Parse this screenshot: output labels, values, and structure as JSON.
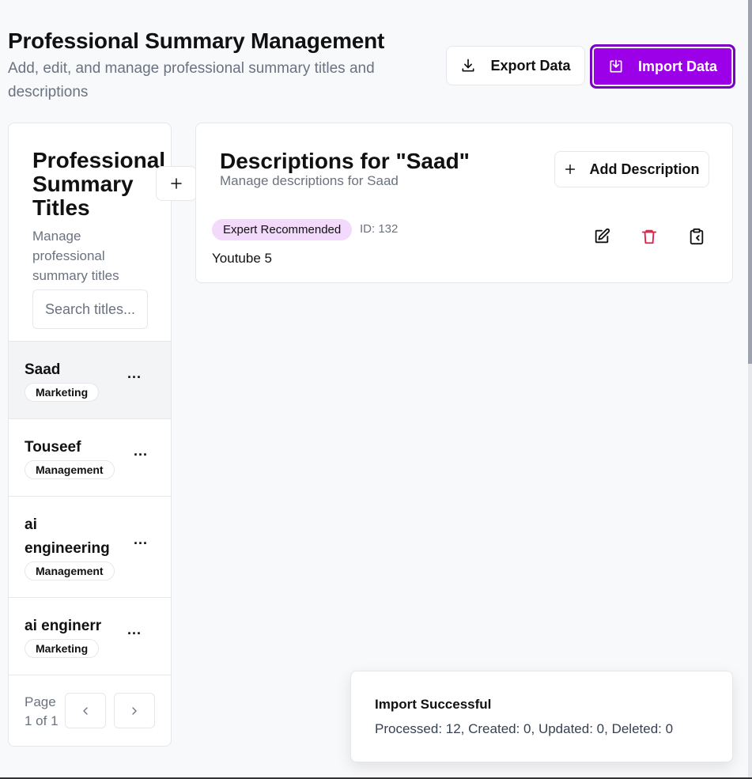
{
  "header": {
    "title": "Professional Summary Management",
    "subtitle": "Add, edit, and manage professional summary titles and descriptions",
    "export_label": "Export Data",
    "import_label": "Import Data"
  },
  "sidebar": {
    "title": "Professional Summary Titles",
    "description": "Manage professional summary titles",
    "search_placeholder": "Search titles...",
    "items": [
      {
        "name": "Saad",
        "category": "Marketing",
        "more": "..."
      },
      {
        "name": "Touseef",
        "category": "Management",
        "more": "..."
      },
      {
        "name": "ai engineering",
        "category": "Management",
        "more": "..."
      },
      {
        "name": "ai enginerr",
        "category": "Marketing",
        "more": "..."
      }
    ],
    "pager_label": "Page 1 of 1"
  },
  "main": {
    "title": "Descriptions for \"Saad\"",
    "subtitle": "Manage descriptions for Saad",
    "add_label": "Add Description",
    "descriptions": [
      {
        "badge": "Expert Recommended",
        "id": "ID: 132",
        "text": "Youtube 5"
      }
    ]
  },
  "toast": {
    "title": "Import Successful",
    "message": "Processed: 12, Created: 0, Updated: 0, Deleted: 0"
  },
  "colors": {
    "accent": "#9b00e8",
    "badge_bg": "#f3d9fb",
    "delete": "#e11d48"
  }
}
